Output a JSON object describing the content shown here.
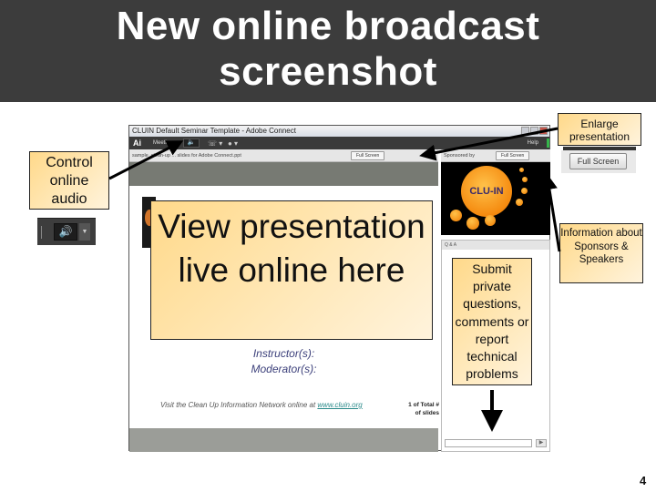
{
  "slide": {
    "title_line1": "New online broadcast",
    "title_line2": "screenshot",
    "page_number": "4"
  },
  "app": {
    "window_title": "CLUIN Default Seminar Template - Adobe Connect",
    "menubar": {
      "logo": "Ai",
      "meeting_label": "Meeting",
      "audio_icon": "speaker-icon",
      "phone_icon": "phone-icon",
      "camera_icon": "webcam-icon",
      "help_label": "Help"
    },
    "share_pod": {
      "header": "sample_clean-up ... slides for Adobe Connect.ppt",
      "full_screen_label": "Full Screen"
    },
    "sponsor_pod": {
      "header": "Sponsored by",
      "full_screen_label": "Full Screen",
      "logo_text": "CLU-IN"
    },
    "slide_content": {
      "instructors": "Instructor(s):",
      "moderators": "Moderator(s):",
      "footer_prefix": "Visit the Clean Up Information Network online at ",
      "footer_link": "www.cluin.org",
      "slide_count_line1": "1 of Total #",
      "slide_count_line2": "of slides"
    },
    "qa_pod": {
      "header": "Q & A",
      "input_value": "",
      "send_icon": "send-icon"
    }
  },
  "callouts": {
    "enlarge": "Enlarge presentation",
    "audio": "Control online audio",
    "view": "View presentation live online here",
    "submit": "Submit private questions, comments or report technical problems",
    "info": "Information about Sponsors & Speakers"
  },
  "audio_widget": {
    "icon": "speaker-icon",
    "dropdown_icon": "chevron-down-icon"
  },
  "fullscreen_widget": {
    "label": "Full Screen"
  }
}
